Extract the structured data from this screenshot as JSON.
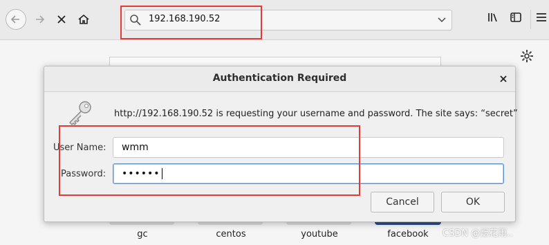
{
  "browser": {
    "url": "192.168.190.52"
  },
  "dialog": {
    "title": "Authentication Required",
    "message": "http://192.168.190.52 is requesting your username and password. The site says: “secret”",
    "username_label": "User Name:",
    "username_value": "wmm",
    "password_label": "Password:",
    "password_mask": "••••••",
    "cancel_label": "Cancel",
    "ok_label": "OK"
  },
  "tiles": [
    "gc",
    "centos",
    "youtube",
    "facebook"
  ],
  "watermark": "CSDN @烟花雨.."
}
